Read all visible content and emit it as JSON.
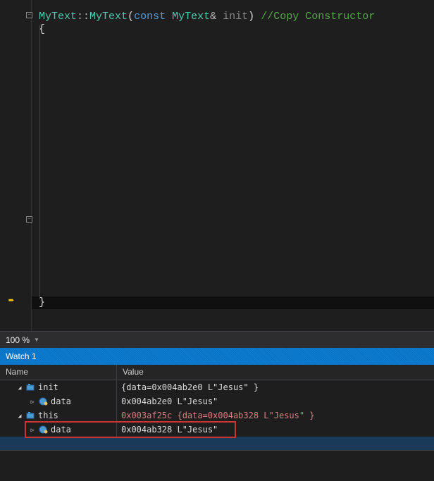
{
  "code": {
    "type_name": "MyText",
    "scope": "::",
    "ctor": "MyText",
    "const_kw": "const",
    "param_type": "MyText",
    "ref": "&",
    "param_name": "init",
    "comment": "//Copy Constructor",
    "open_brace": "{",
    "close_brace": "}"
  },
  "zoom": {
    "level": "100 %"
  },
  "watch": {
    "title": "Watch 1",
    "cols": {
      "name": "Name",
      "value": "Value"
    },
    "vars": [
      {
        "name": "init",
        "value": "{data=0x004ab2e0 L\"Jesus\" }",
        "changed": false
      },
      {
        "name": "data",
        "value": "0x004ab2e0 L\"Jesus\"",
        "changed": false
      },
      {
        "name": "this",
        "value": "0x003af25c {data=0x004ab328 L\"Jesus\" }",
        "changed": true
      },
      {
        "name": "data",
        "value": "0x004ab328 L\"Jesus\"",
        "changed": false
      }
    ]
  }
}
